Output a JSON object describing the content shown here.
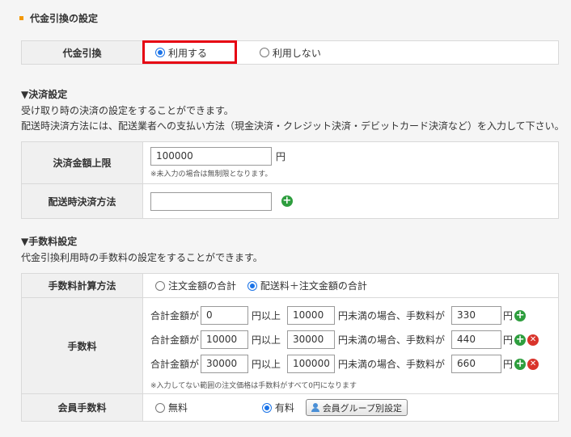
{
  "section_title": "代金引換の設定",
  "cod": {
    "label": "代金引換",
    "option_use": "利用する",
    "option_not_use": "利用しない"
  },
  "payment": {
    "heading": "▼決済設定",
    "desc1": "受け取り時の決済の設定をすることができます。",
    "desc2": "配送時決済方法には、配送業者への支払い方法（現金決済・クレジット決済・デビットカード決済など）を入力して下さい。",
    "limit_label": "決済金額上限",
    "limit_value": "100000",
    "limit_unit": "円",
    "limit_hint": "※未入力の場合は無制限となります。",
    "method_label": "配送時決済方法",
    "method_value": ""
  },
  "fee": {
    "heading": "▼手数料設定",
    "desc": "代金引換利用時の手数料の設定をすることができます。",
    "calc_label": "手数料計算方法",
    "calc_option1": "注文金額の合計",
    "calc_option2": "配送料＋注文金額の合計",
    "fee_label": "手数料",
    "text_total": "合計金額が",
    "text_over": "円以上",
    "text_under": "円未満の場合、手数料が",
    "text_yen": "円",
    "rows": [
      {
        "min": "0",
        "max": "10000",
        "fee": "330"
      },
      {
        "min": "10000",
        "max": "30000",
        "fee": "440"
      },
      {
        "min": "30000",
        "max": "100000",
        "fee": "660"
      }
    ],
    "fee_hint": "※入力してない範囲の注文価格は手数料がすべて0円になります",
    "member_label": "会員手数料",
    "member_free": "無料",
    "member_paid": "有料",
    "member_group_button": "会員グループ別設定"
  },
  "colors": {
    "accent": "#f39800",
    "radio_checked": "#1a73e8",
    "highlight": "#e60012",
    "add": "#2e9e3e",
    "remove": "#d9342b"
  }
}
